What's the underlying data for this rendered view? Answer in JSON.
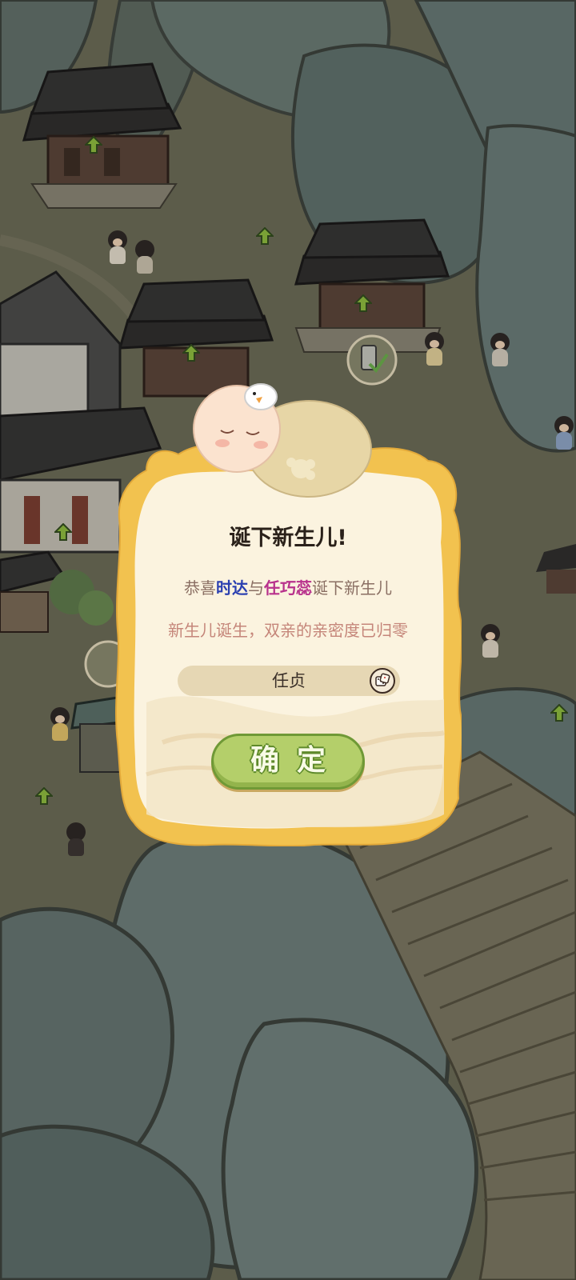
{
  "dialog": {
    "title": "诞下新生儿!",
    "congrats_prefix": "恭喜",
    "father_name": "时达",
    "connector": "与",
    "mother_name": "任巧蕊",
    "congrats_suffix": "诞下新生儿",
    "notice": "新生儿诞生，双亲的亲密度已归零",
    "baby_name": "任贞",
    "randomize_icon": "dice-icon",
    "confirm_label": "确定"
  },
  "colors": {
    "father_name": "#2a3fb0",
    "mother_name": "#b8318c",
    "notice": "#c5867a",
    "confirm_button": "#b4cf6a",
    "dialog_panel": "#fbf3df",
    "dialog_border": "#f2c45a"
  }
}
